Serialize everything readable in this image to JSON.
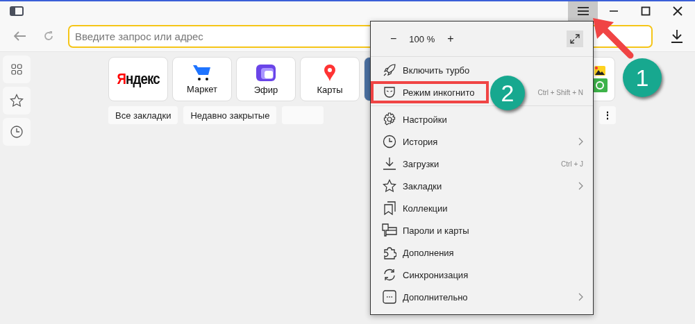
{
  "title_bar": {
    "menu_button": {
      "selected": true
    }
  },
  "toolbar": {
    "address_placeholder": "Введите запрос или адрес"
  },
  "tiles": [
    {
      "kind": "logo",
      "text": "Яндекс"
    },
    {
      "kind": "app",
      "label": "Маркет"
    },
    {
      "kind": "app",
      "label": "Эфир"
    },
    {
      "kind": "app",
      "label": "Карты"
    }
  ],
  "bookmark_buttons": [
    "Все закладки",
    "Недавно закрытые"
  ],
  "more_button": "⋮",
  "menu": {
    "zoom": {
      "minus": "−",
      "value": "100 %",
      "plus": "+"
    },
    "sections": [
      [
        {
          "label": "Включить турбо",
          "submenu": false,
          "highlighted": false
        },
        {
          "label": "Режим инкогнито",
          "shortcut": "Ctrl + Shift + N",
          "submenu": false,
          "highlighted": true
        }
      ],
      [
        {
          "label": "Настройки",
          "submenu": false,
          "highlighted": false
        },
        {
          "label": "История",
          "submenu": true,
          "highlighted": false
        },
        {
          "label": "Загрузки",
          "shortcut": "Ctrl + J",
          "submenu": false,
          "highlighted": false
        },
        {
          "label": "Закладки",
          "submenu": true,
          "highlighted": false
        },
        {
          "label": "Коллекции",
          "submenu": false,
          "highlighted": false
        },
        {
          "label": "Пароли и карты",
          "submenu": false,
          "highlighted": false
        },
        {
          "label": "Дополнения",
          "submenu": false,
          "highlighted": false
        },
        {
          "label": "Синхронизация",
          "submenu": false,
          "highlighted": false
        },
        {
          "label": "Дополнительно",
          "submenu": true,
          "highlighted": false
        }
      ]
    ]
  },
  "callouts": [
    {
      "number": "1"
    },
    {
      "number": "2"
    }
  ]
}
